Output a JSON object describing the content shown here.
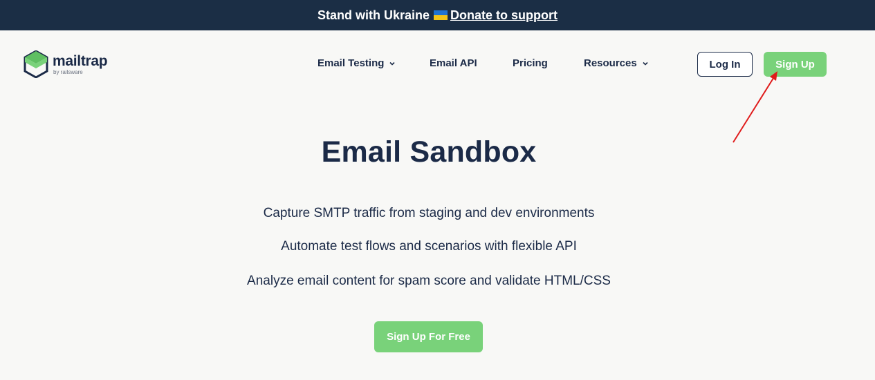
{
  "banner": {
    "text": "Stand with Ukraine",
    "link": "Donate to support"
  },
  "logo": {
    "name": "mailtrap",
    "subtitle": "by railsware",
    "color": "#79d27a"
  },
  "nav": {
    "items": [
      {
        "label": "Email Testing",
        "dropdown": true
      },
      {
        "label": "Email API",
        "dropdown": false
      },
      {
        "label": "Pricing",
        "dropdown": false
      },
      {
        "label": "Resources",
        "dropdown": true
      }
    ],
    "login_label": "Log In",
    "signup_label": "Sign Up"
  },
  "hero": {
    "title": "Email Sandbox",
    "features": [
      "Capture SMTP traffic from staging and dev environments",
      "Automate test flows and scenarios with flexible API",
      "Analyze email content for spam score and validate HTML/CSS"
    ],
    "cta_label": "Sign Up For Free"
  },
  "colors": {
    "banner_bg": "#1b2e45",
    "accent_green": "#79d27a",
    "text_dark": "#1b2a47",
    "annotation_arrow": "#e01b1b"
  }
}
